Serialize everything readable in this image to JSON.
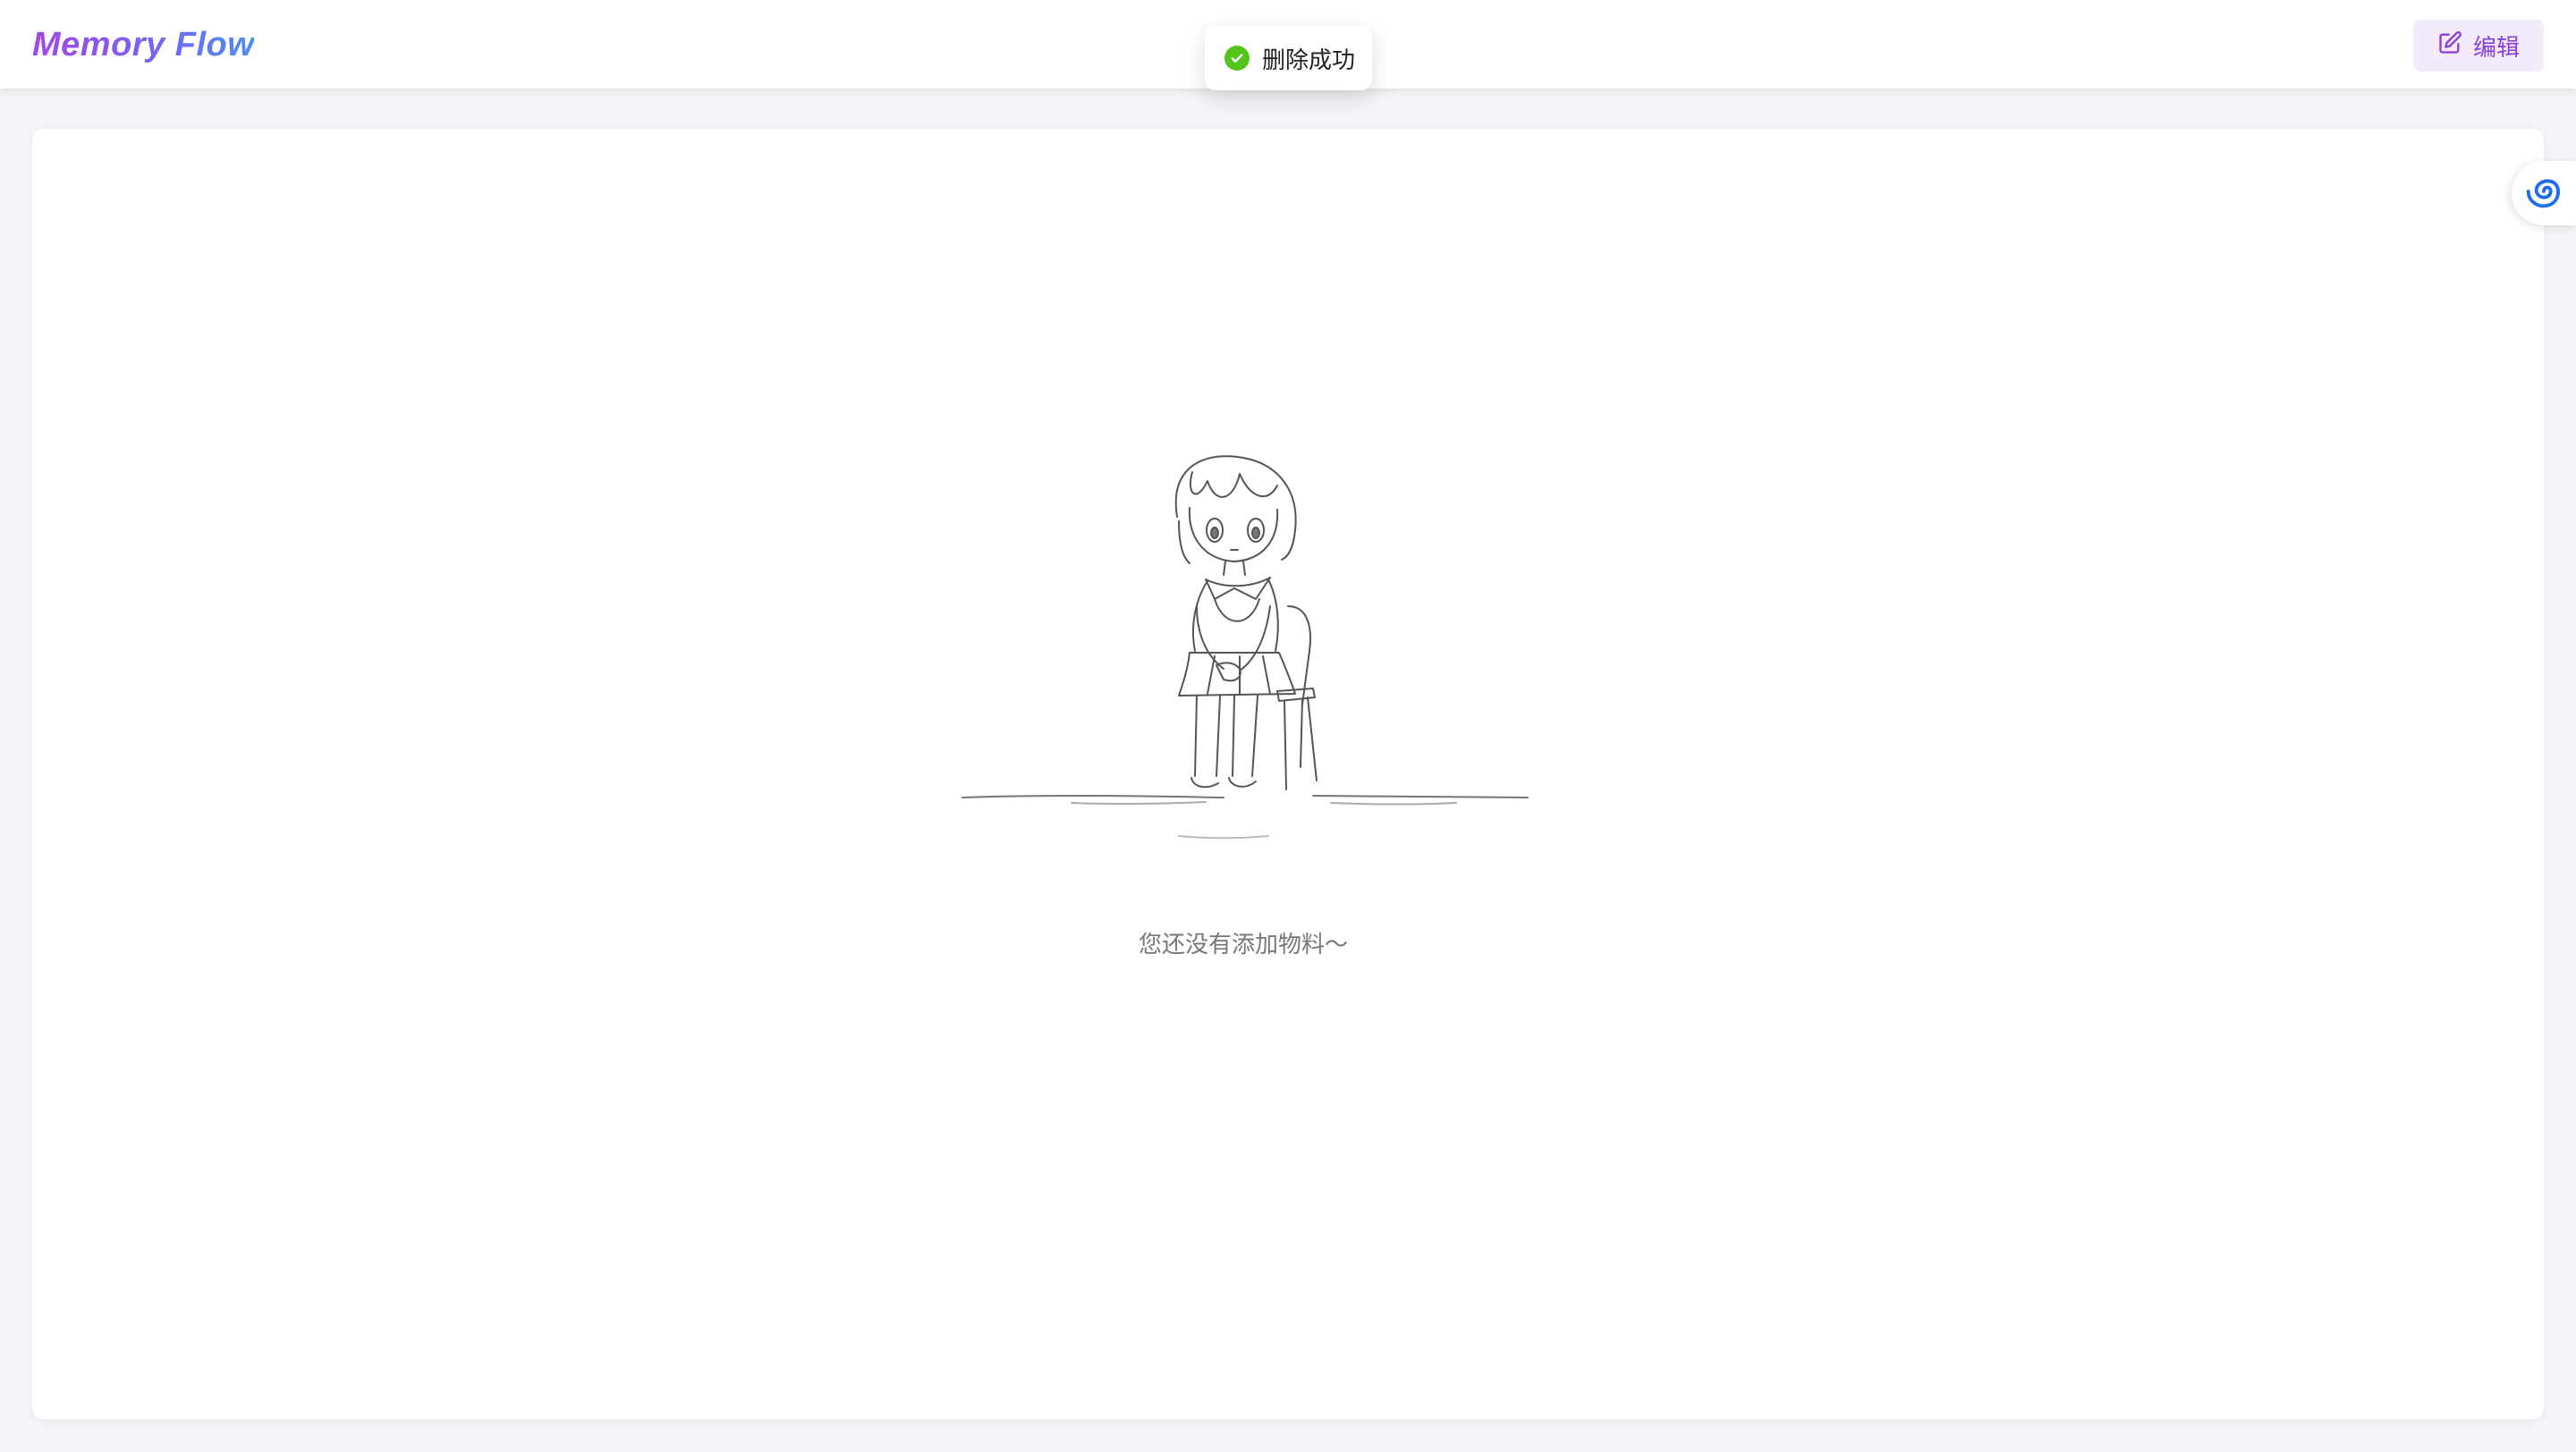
{
  "header": {
    "logo": "Memory Flow",
    "edit_label": "编辑"
  },
  "toast": {
    "message": "删除成功",
    "status_color": "#52c41a"
  },
  "main": {
    "empty_text": "您还没有添加物料～"
  },
  "icons": {
    "edit": "edit-icon",
    "success": "check-circle-icon",
    "widget": "swirl-icon"
  },
  "colors": {
    "brand_gradient_start": "#a646e6",
    "brand_gradient_end": "#4d8df0",
    "accent": "#8a3fd6"
  }
}
